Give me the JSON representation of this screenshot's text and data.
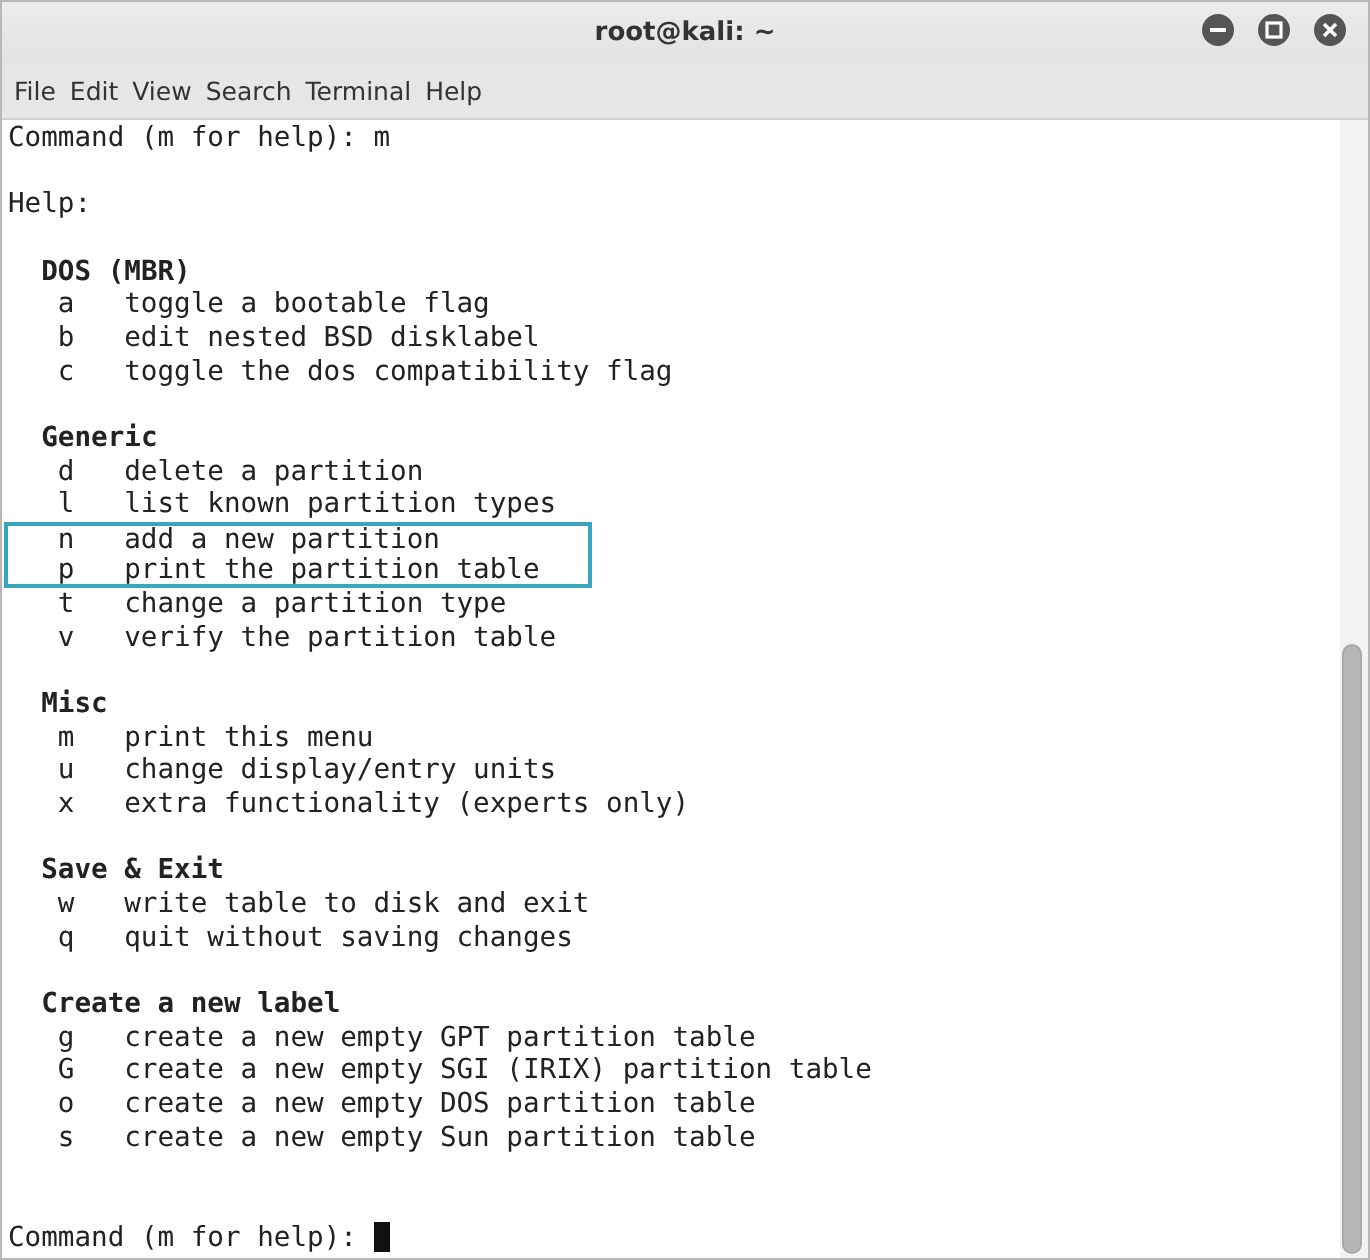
{
  "window": {
    "title": "root@kali: ~"
  },
  "menu": [
    "File",
    "Edit",
    "View",
    "Search",
    "Terminal",
    "Help"
  ],
  "terminal": {
    "prompt": "Command (m for help): ",
    "input": "m",
    "help_heading": "Help:",
    "sections": [
      {
        "title": "DOS (MBR)",
        "commands": [
          {
            "key": "a",
            "description": "toggle a bootable flag",
            "highlighted": false
          },
          {
            "key": "b",
            "description": "edit nested BSD disklabel",
            "highlighted": false
          },
          {
            "key": "c",
            "description": "toggle the dos compatibility flag",
            "highlighted": false
          }
        ]
      },
      {
        "title": "Generic",
        "commands": [
          {
            "key": "d",
            "description": "delete a partition",
            "highlighted": false
          },
          {
            "key": "l",
            "description": "list known partition types",
            "highlighted": false
          },
          {
            "key": "n",
            "description": "add a new partition",
            "highlighted": true
          },
          {
            "key": "p",
            "description": "print the partition table",
            "highlighted": true
          },
          {
            "key": "t",
            "description": "change a partition type",
            "highlighted": false
          },
          {
            "key": "v",
            "description": "verify the partition table",
            "highlighted": false
          }
        ]
      },
      {
        "title": "Misc",
        "commands": [
          {
            "key": "m",
            "description": "print this menu",
            "highlighted": false
          },
          {
            "key": "u",
            "description": "change display/entry units",
            "highlighted": false
          },
          {
            "key": "x",
            "description": "extra functionality (experts only)",
            "highlighted": false
          }
        ]
      },
      {
        "title": "Save & Exit",
        "commands": [
          {
            "key": "w",
            "description": "write table to disk and exit",
            "highlighted": false
          },
          {
            "key": "q",
            "description": "quit without saving changes",
            "highlighted": false
          }
        ]
      },
      {
        "title": "Create a new label",
        "commands": [
          {
            "key": "g",
            "description": "create a new empty GPT partition table",
            "highlighted": false
          },
          {
            "key": "G",
            "description": "create a new empty SGI (IRIX) partition table",
            "highlighted": false
          },
          {
            "key": "o",
            "description": "create a new empty DOS partition table",
            "highlighted": false
          },
          {
            "key": "s",
            "description": "create a new empty Sun partition table",
            "highlighted": false
          }
        ]
      }
    ],
    "final_prompt": "Command (m for help): "
  }
}
